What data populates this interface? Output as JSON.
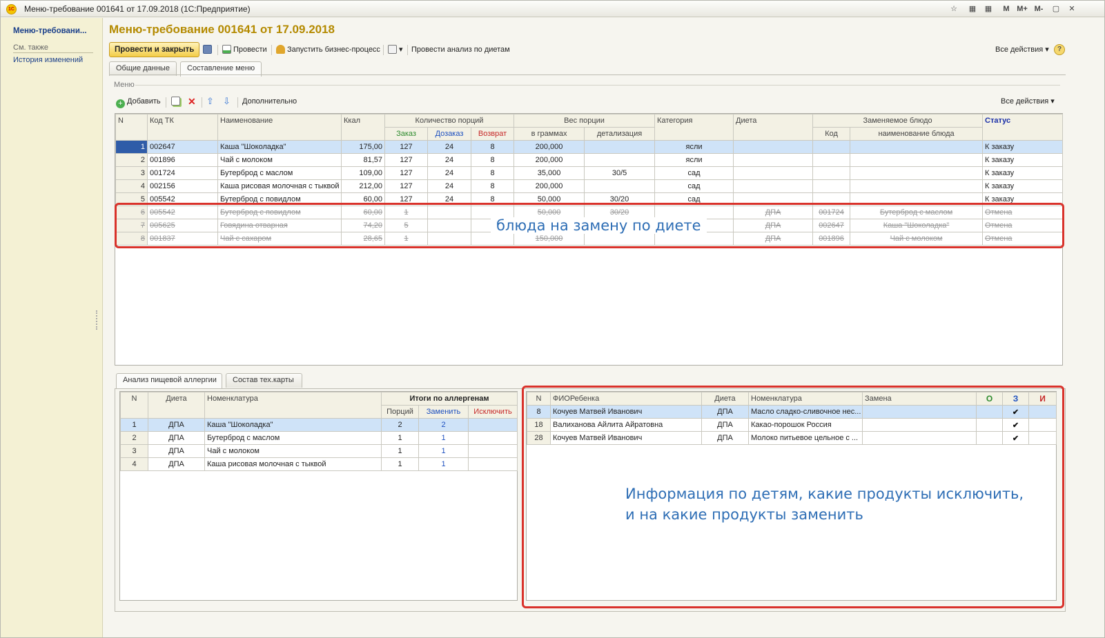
{
  "window": {
    "title": "Меню-требование 001641 от 17.09.2018  (1С:Предприятие)",
    "app_icon": "1С",
    "title_buttons": [
      "☆",
      "▦",
      "▦",
      "M",
      "M+",
      "M-",
      "▢",
      "✕"
    ]
  },
  "sidebar": {
    "current": "Меню-требовани...",
    "see_also": "См. также",
    "history": "История изменений"
  },
  "doc": {
    "title": "Меню-требование 001641 от 17.09.2018"
  },
  "toolbar": {
    "post_close": "Провести и закрыть",
    "post": "Провести",
    "start_bp": "Запустить бизнес-процесс",
    "analyze": "Провести анализ по диетам",
    "all_actions": "Все действия ▾",
    "help": "?"
  },
  "tabs": {
    "general": "Общие данные",
    "menu": "Составление меню"
  },
  "menu_panel": {
    "label": "Меню",
    "add": "Добавить",
    "more": "Дополнительно",
    "all_actions": "Все действия ▾"
  },
  "main_grid": {
    "headers": {
      "n": "N",
      "code": "Код ТК",
      "name": "Наименование",
      "kcal": "Ккал",
      "portions": "Количество порций",
      "order": "Заказ",
      "extra": "Дозаказ",
      "ret": "Возврат",
      "weight": "Вес порции",
      "grams": "в граммах",
      "detail": "детализация",
      "category": "Категория",
      "diet": "Диета",
      "replaced": "Заменяемое блюдо",
      "rcode": "Код",
      "rname": "наименование блюда",
      "status": "Статус"
    },
    "rows": [
      {
        "n": "1",
        "code": "002647",
        "name": "Каша \"Шоколадка\"",
        "kcal": "175,00",
        "order": "127",
        "extra": "24",
        "ret": "8",
        "grams": "200,000",
        "detail": "",
        "category": "ясли",
        "diet": "",
        "rcode": "",
        "rname": "",
        "status": "К заказу"
      },
      {
        "n": "2",
        "code": "001896",
        "name": "Чай с молоком",
        "kcal": "81,57",
        "order": "127",
        "extra": "24",
        "ret": "8",
        "grams": "200,000",
        "detail": "",
        "category": "ясли",
        "diet": "",
        "rcode": "",
        "rname": "",
        "status": "К заказу"
      },
      {
        "n": "3",
        "code": "001724",
        "name": "Бутерброд с маслом",
        "kcal": "109,00",
        "order": "127",
        "extra": "24",
        "ret": "8",
        "grams": "35,000",
        "detail": "30/5",
        "category": "сад",
        "diet": "",
        "rcode": "",
        "rname": "",
        "status": "К заказу"
      },
      {
        "n": "4",
        "code": "002156",
        "name": "Каша рисовая молочная с тыквой",
        "kcal": "212,00",
        "order": "127",
        "extra": "24",
        "ret": "8",
        "grams": "200,000",
        "detail": "",
        "category": "сад",
        "diet": "",
        "rcode": "",
        "rname": "",
        "status": "К заказу"
      },
      {
        "n": "5",
        "code": "005542",
        "name": "Бутерброд с повидлом",
        "kcal": "60,00",
        "order": "127",
        "extra": "24",
        "ret": "8",
        "grams": "50,000",
        "detail": "30/20",
        "category": "сад",
        "diet": "",
        "rcode": "",
        "rname": "",
        "status": "К заказу"
      },
      {
        "n": "6",
        "code": "005542",
        "name": "Бутерброд с повидлом",
        "kcal": "60,00",
        "order": "1",
        "extra": "",
        "ret": "",
        "grams": "50,000",
        "detail": "30/20",
        "category": "",
        "diet": "ДПА",
        "rcode": "001724",
        "rname": "Бутерброд с маслом",
        "status": "Отмена"
      },
      {
        "n": "7",
        "code": "005625",
        "name": "Говядина отварная",
        "kcal": "74,20",
        "order": "5",
        "extra": "",
        "ret": "",
        "grams": "",
        "detail": "",
        "category": "",
        "diet": "ДПА",
        "rcode": "002647",
        "rname": "Каша \"Шоколадка\"",
        "status": "Отмена"
      },
      {
        "n": "8",
        "code": "001837",
        "name": "Чай с сахаром",
        "kcal": "28,65",
        "order": "1",
        "extra": "",
        "ret": "",
        "grams": "150,000",
        "detail": "",
        "category": "",
        "diet": "ДПА",
        "rcode": "001896",
        "rname": "Чай с молоком",
        "status": "Отмена"
      }
    ]
  },
  "annotation_top": "блюда на замену по диете",
  "lower_tabs": {
    "allergy": "Анализ пищевой аллергии",
    "techcard": "Состав тех.карты"
  },
  "allergy_grid": {
    "headers": {
      "n": "N",
      "diet": "Диета",
      "nom": "Номенклатура",
      "totals": "Итоги по аллергенам",
      "portions": "Порций",
      "replace": "Заменить",
      "exclude": "Исключить"
    },
    "rows": [
      {
        "n": "1",
        "diet": "ДПА",
        "nom": "Каша \"Шоколадка\"",
        "portions": "2",
        "replace": "2",
        "exclude": ""
      },
      {
        "n": "2",
        "diet": "ДПА",
        "nom": "Бутерброд с маслом",
        "portions": "1",
        "replace": "1",
        "exclude": ""
      },
      {
        "n": "3",
        "diet": "ДПА",
        "nom": "Чай с молоком",
        "portions": "1",
        "replace": "1",
        "exclude": ""
      },
      {
        "n": "4",
        "diet": "ДПА",
        "nom": "Каша рисовая молочная с тыквой",
        "portions": "1",
        "replace": "1",
        "exclude": ""
      }
    ]
  },
  "children_grid": {
    "headers": {
      "n": "N",
      "fio": "ФИОРебенка",
      "diet": "Диета",
      "nom": "Номенклатура",
      "repl": "Замена",
      "o": "О",
      "z": "З",
      "i": "И"
    },
    "rows": [
      {
        "n": "8",
        "fio": "Кочуев Матвей Иванович",
        "diet": "ДПА",
        "nom": "Масло сладко-сливочное нес...",
        "repl": "",
        "o": "",
        "z": "✔",
        "i": ""
      },
      {
        "n": "18",
        "fio": "Валиханова Айлита Айратовна",
        "diet": "ДПА",
        "nom": "Какао-порошок Россия",
        "repl": "",
        "o": "",
        "z": "✔",
        "i": ""
      },
      {
        "n": "28",
        "fio": "Кочуев Матвей Иванович",
        "diet": "ДПА",
        "nom": "Молоко питьевое цельное с ...",
        "repl": "",
        "o": "",
        "z": "✔",
        "i": ""
      }
    ]
  },
  "annotation_bottom": {
    "line1": "Информация по детям, какие продукты исключить,",
    "line2": "и на какие продукты заменить"
  },
  "colors": {
    "order": "#2e8b2e",
    "extra": "#1c4fbf",
    "ret": "#c62828",
    "status_head": "#1a2fa8",
    "accent": "#b48a00",
    "highlight": "#d9322b"
  }
}
